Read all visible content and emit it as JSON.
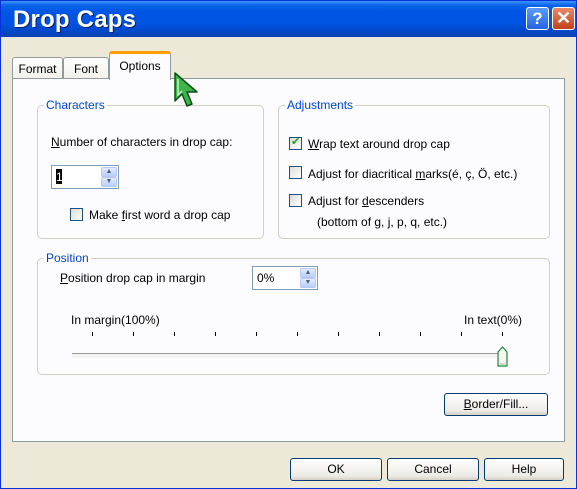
{
  "window": {
    "title": "Drop Caps",
    "help_glyph": "?",
    "close_glyph": "✕"
  },
  "tabs": [
    {
      "label": "Format"
    },
    {
      "label": "Font"
    },
    {
      "label": "Options"
    }
  ],
  "characters": {
    "legend": "Characters",
    "count_prefix": "N",
    "count_label": "umber of characters in drop cap:",
    "count_value": "1",
    "first_word_pre": "Make ",
    "first_word_key": "f",
    "first_word_post": "irst word a drop cap",
    "first_word_checked": false
  },
  "adjustments": {
    "legend": "Adjustments",
    "wrap_key": "W",
    "wrap_post": "rap text around drop cap",
    "wrap_checked": true,
    "diacritical_pre": "Adjust for diacritical ",
    "diacritical_key": "m",
    "diacritical_post": "arks(é, ç, Ö, etc.)",
    "diacritical_checked": false,
    "descenders_pre": "Adjust for ",
    "descenders_key": "d",
    "descenders_post": "escenders",
    "descenders_line2": "(bottom of g, j, p, q, etc.)",
    "descenders_checked": false
  },
  "position": {
    "legend": "Position",
    "margin_key": "P",
    "margin_label": "osition drop cap in margin",
    "margin_value": "0%",
    "left_label": "In margin(100%)",
    "right_label": "In text(0%)",
    "slider_fraction_in_text": 1.0
  },
  "buttons": {
    "border_key": "B",
    "border_label": "order/Fill...",
    "ok": "OK",
    "cancel": "Cancel",
    "help": "Help"
  },
  "colors": {
    "titlebar": "#0054e3",
    "group_legend": "#0046d5",
    "active_tab_accent": "#ff9c00",
    "dialog_bg": "#ece9d8"
  },
  "icons": {
    "cursor": "arrow-pointer-icon",
    "checkmark": "checkmark-icon"
  }
}
